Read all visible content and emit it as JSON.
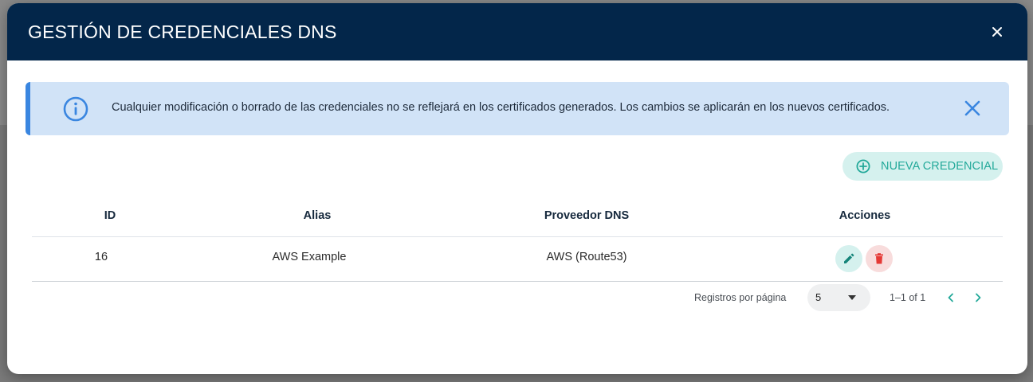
{
  "modal": {
    "title": "GESTIÓN DE CREDENCIALES DNS",
    "close_icon": "close-icon"
  },
  "alert": {
    "icon": "info-icon",
    "message": "Cualquier modificación o borrado de las credenciales no se reflejará en los certificados generados. Los cambios se aplicarán en los nuevos certificados.",
    "close_icon": "close-icon",
    "accent_color": "#3a86e0",
    "background_color": "#d1e3f7"
  },
  "toolbar": {
    "new_credential_label": "NUEVA CREDENCIAL",
    "new_credential_icon": "plus-circle-icon",
    "accent_color": "#23a99a"
  },
  "table": {
    "columns": [
      "ID",
      "Alias",
      "Proveedor DNS",
      "Acciones"
    ],
    "rows": [
      {
        "id": "16",
        "alias": "AWS Example",
        "provider": "AWS (Route53)"
      }
    ],
    "row_actions": [
      "edit-icon",
      "trash-icon"
    ]
  },
  "pagination": {
    "rows_per_page_label": "Registros por página",
    "rows_per_page_value": "5",
    "range_text": "1–1 of 1",
    "prev_icon": "chevron-left-icon",
    "next_icon": "chevron-right-icon"
  },
  "colors": {
    "header_bg": "#03264a",
    "delete_color": "#e53935",
    "edit_color": "#15857a"
  }
}
